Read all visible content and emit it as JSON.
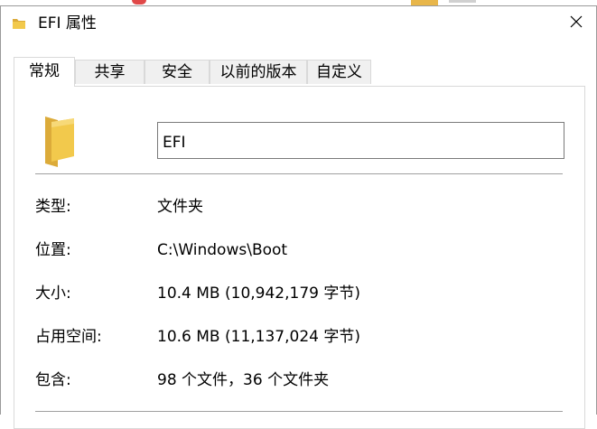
{
  "window": {
    "title": "EFI 属性"
  },
  "tabs": [
    {
      "label": "常规",
      "active": true
    },
    {
      "label": "共享",
      "active": false
    },
    {
      "label": "安全",
      "active": false
    },
    {
      "label": "以前的版本",
      "active": false
    },
    {
      "label": "自定义",
      "active": false
    }
  ],
  "general": {
    "name_value": "EFI",
    "props": [
      {
        "label": "类型:",
        "value": "文件夹"
      },
      {
        "label": "位置:",
        "value": "C:\\Windows\\Boot"
      },
      {
        "label": "大小:",
        "value": "10.4 MB (10,942,179 字节)"
      },
      {
        "label": "占用空间:",
        "value": "10.6 MB (11,137,024 字节)"
      },
      {
        "label": "包含:",
        "value": "98 个文件，36 个文件夹"
      }
    ]
  },
  "icons": {
    "title": "folder-icon",
    "close": "close-icon",
    "large": "folder-large-icon"
  },
  "colors": {
    "folder_body": "#f2c94c",
    "folder_back": "#dcab3a",
    "tab_inactive": "#f0f0f0",
    "border": "#d9d9d9"
  }
}
